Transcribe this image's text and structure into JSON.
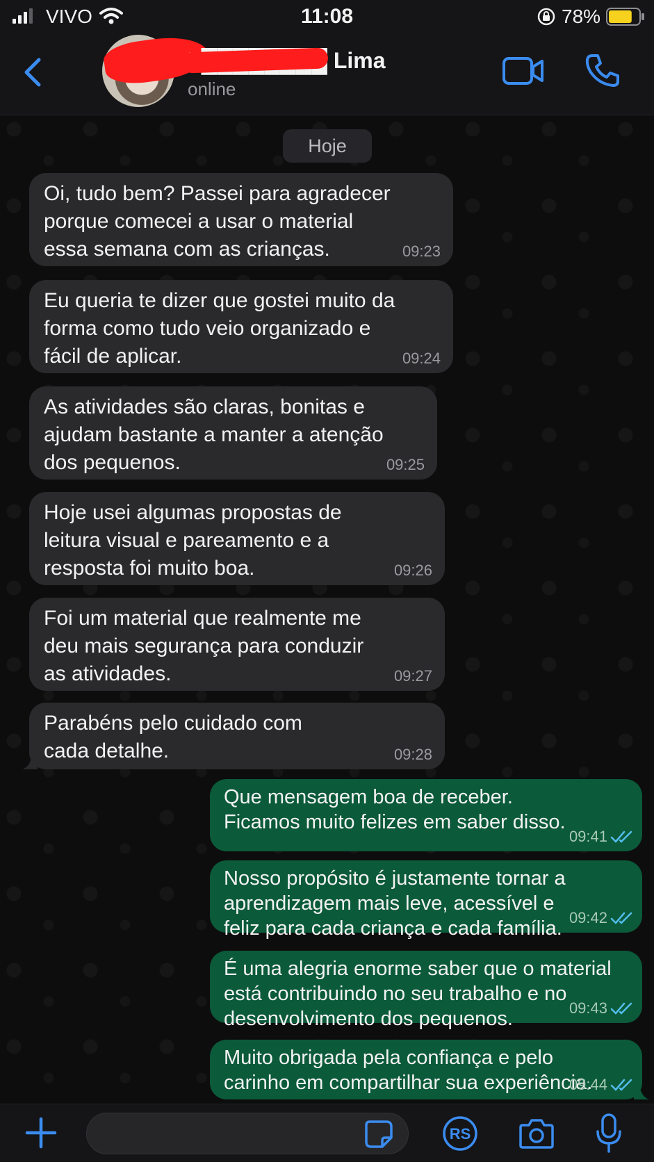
{
  "status_bar": {
    "carrier": "VIVO",
    "time": "11:08",
    "battery_percent": "78%",
    "battery_level": 0.78,
    "icons": [
      "signal-icon",
      "wifi-icon",
      "rotation-lock-icon",
      "battery-icon"
    ]
  },
  "header": {
    "back_icon": "chevron-left-icon",
    "contact_name": "F████████ Lima",
    "status": "online",
    "actions": [
      "video-call-icon",
      "voice-call-icon"
    ]
  },
  "chat": {
    "date_separator": "Hoje",
    "messages": [
      {
        "direction": "incoming",
        "text": "Oi, tudo bem? Passei para agradecer\nporque comecei a usar o material\nessa semana com as crianças.",
        "time": "09:23"
      },
      {
        "direction": "incoming",
        "text": "Eu queria te dizer que gostei muito da\nforma como tudo veio organizado e\nfácil de aplicar.",
        "time": "09:24"
      },
      {
        "direction": "incoming",
        "text": "As atividades são claras, bonitas e\najudam bastante a manter a atenção\ndos pequenos.",
        "time": "09:25"
      },
      {
        "direction": "incoming",
        "text": "Hoje usei algumas propostas de\nleitura visual e pareamento e a\nresposta foi muito boa.",
        "time": "09:26"
      },
      {
        "direction": "incoming",
        "text": "Foi um material que realmente me\ndeu mais segurança para conduzir\nas atividades.",
        "time": "09:27"
      },
      {
        "direction": "incoming",
        "text": "Parabéns pelo cuidado com\ncada detalhe.",
        "time": "09:28"
      },
      {
        "direction": "outgoing",
        "text": "Que mensagem boa de receber.\nFicamos muito felizes em saber disso.",
        "time": "09:41",
        "status": "read"
      },
      {
        "direction": "outgoing",
        "text": "Nosso propósito é justamente tornar a\naprendizagem mais leve, acessível e\nfeliz para cada criança e cada família.",
        "time": "09:42",
        "status": "read"
      },
      {
        "direction": "outgoing",
        "text": "É uma alegria enorme saber que o material\nestá contribuindo no seu trabalho e no\ndesenvolvimento dos pequenos.",
        "time": "09:43",
        "status": "read"
      },
      {
        "direction": "outgoing",
        "text": "Muito obrigada pela confiança e pelo\ncarinho em compartilhar sua experiência.",
        "time": "09:44",
        "status": "read"
      }
    ]
  },
  "input_bar": {
    "add_icon": "plus-icon",
    "placeholder": "",
    "sticker_icon": "sticker-icon",
    "rs_label": "RS",
    "camera_icon": "camera-icon",
    "mic_icon": "microphone-icon"
  },
  "colors": {
    "accent": "#3b8cf0",
    "incoming_bubble": "#2a2a2d",
    "outgoing_bubble": "#0b5a3a",
    "read_ticks": "#53bdeb",
    "battery": "#f6d21e",
    "redaction": "#ff1c1c"
  }
}
